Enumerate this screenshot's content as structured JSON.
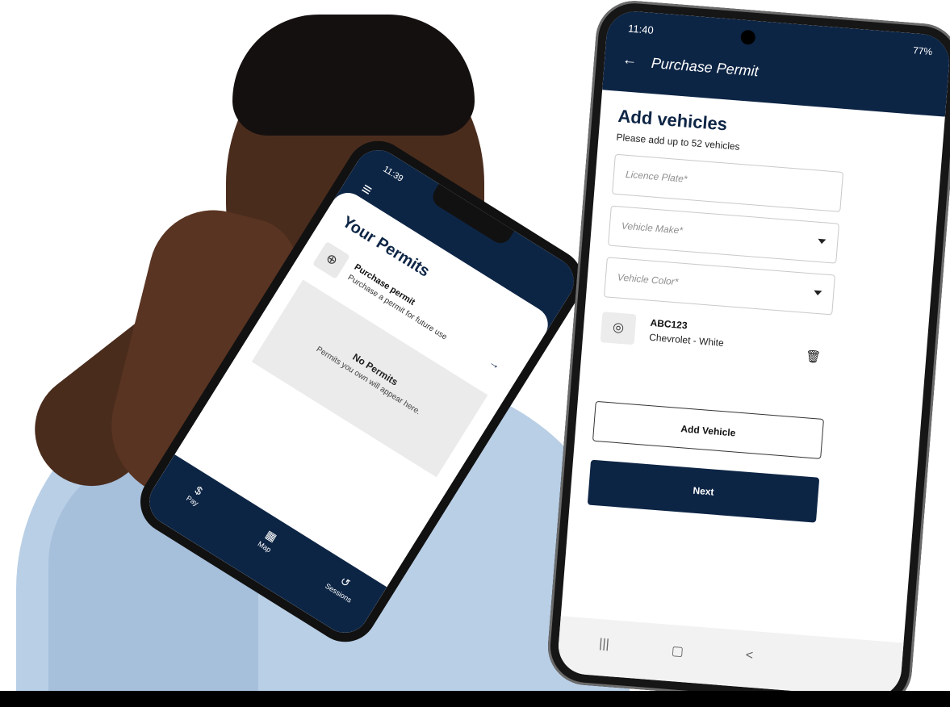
{
  "left_phone": {
    "time": "11:39",
    "menu_icon": "menu-icon",
    "title": "Your Permits",
    "purchase_item": {
      "icon": "plus-circle-icon",
      "title": "Purchase permit",
      "subtitle": "Purchase a permit for future use",
      "arrow": "→"
    },
    "empty_state": {
      "title": "No Permits",
      "subtitle": "Permits you own will appear here."
    },
    "nav": [
      {
        "icon": "$",
        "label": "Pay"
      },
      {
        "icon": "▦",
        "label": "Map"
      },
      {
        "icon": "↺",
        "label": "Sessions"
      }
    ]
  },
  "right_phone": {
    "time": "11:40",
    "battery": "77%",
    "header": {
      "back": "←",
      "title": "Purchase Permit"
    },
    "heading": "Add vehicles",
    "subheading": "Please add up to 52 vehicles",
    "fields": {
      "licence_plate": "Licence Plate*",
      "vehicle_make": "Vehicle Make*",
      "vehicle_color": "Vehicle Color*"
    },
    "vehicle": {
      "plate": "ABC123",
      "description": "Chevrolet - White"
    },
    "buttons": {
      "add_vehicle": "Add Vehicle",
      "next": "Next"
    },
    "system_nav": [
      "|||",
      "▢",
      "<"
    ]
  }
}
